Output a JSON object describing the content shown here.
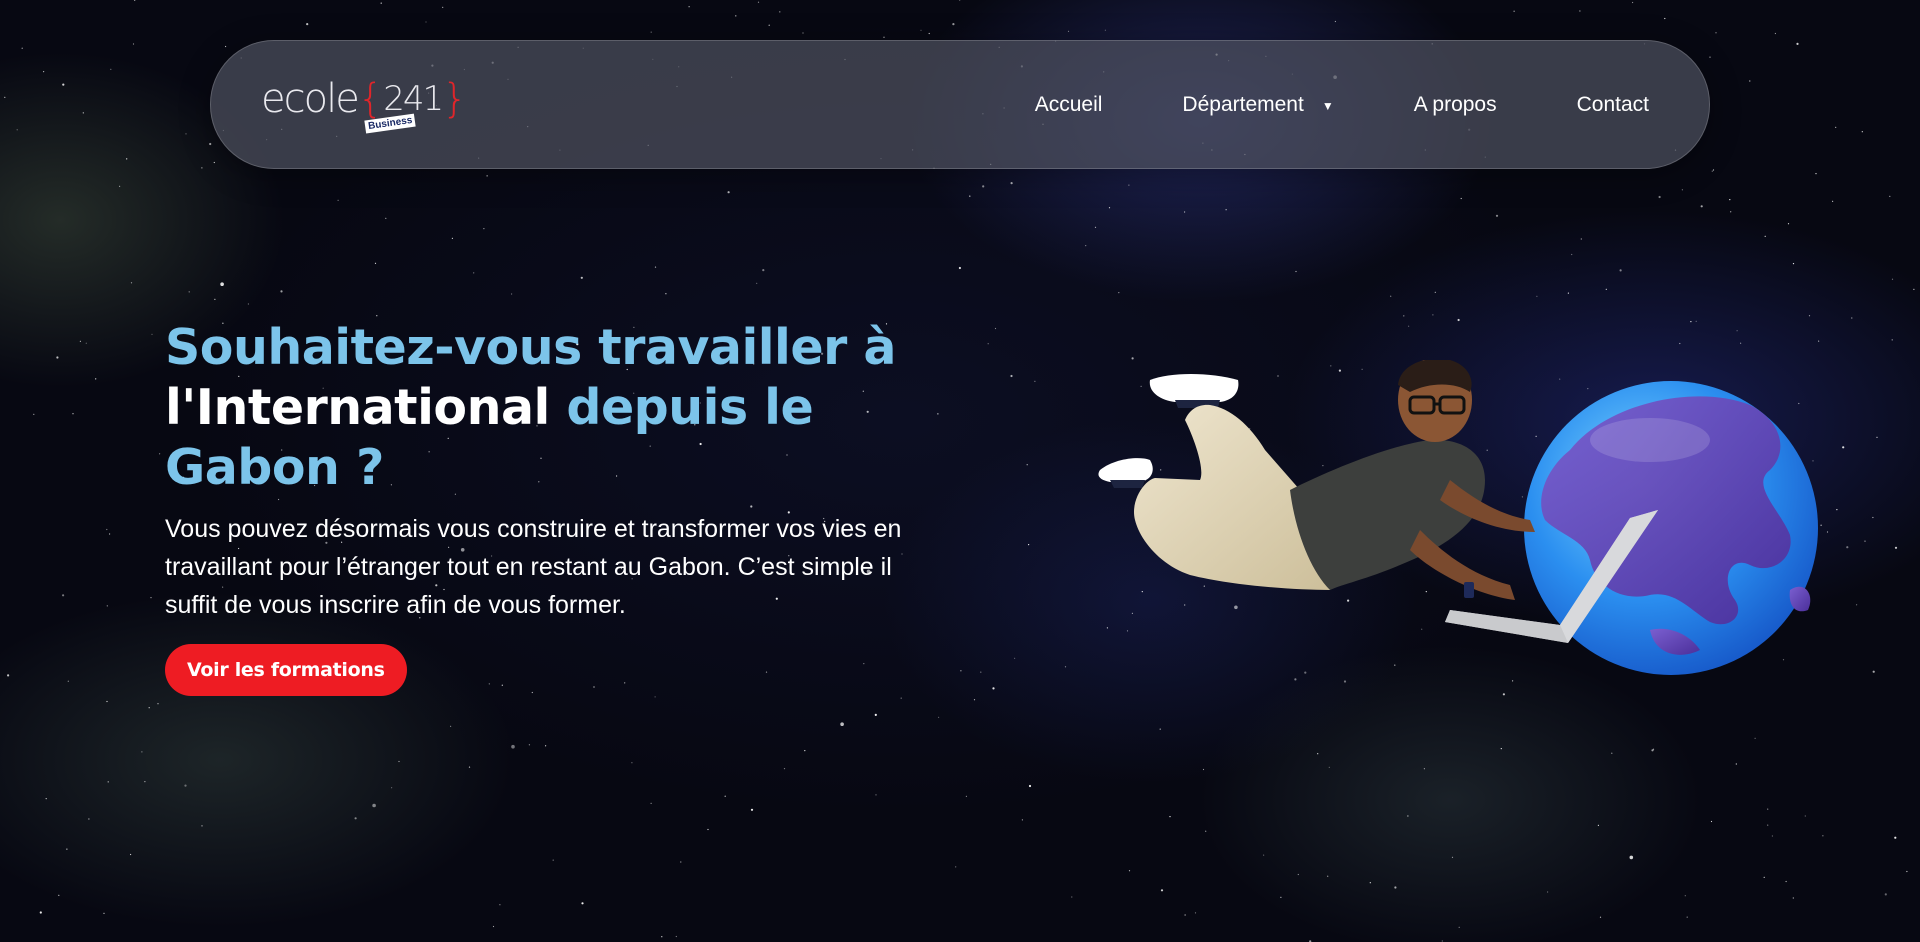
{
  "logo": {
    "word": "ecole",
    "open_brace": "{",
    "number": "241",
    "close_brace": "}",
    "tag": "Business"
  },
  "nav": {
    "items": [
      {
        "label": "Accueil"
      },
      {
        "label": "Département",
        "has_dropdown": true
      },
      {
        "label": "A propos"
      },
      {
        "label": "Contact"
      }
    ],
    "dropdown_glyph": "▼"
  },
  "hero": {
    "headline_part1": "Souhaitez-vous travailler à",
    "headline_part2": "l'International",
    "headline_part3": "depuis le Gabon ?",
    "subtitle": "Vous pouvez désormais vous construire et transformer vos vies en travaillant pour l’étranger tout en restant au Gabon. C’est simple il suffit de vous inscrire afin de vous former.",
    "cta_label": "Voir les formations"
  },
  "colors": {
    "accent_blue": "#7cc4ea",
    "cta_red": "#ee1c23",
    "logo_red": "#e0252a",
    "background": "#070812"
  },
  "illustration": {
    "icon": "person-flying-with-laptop-and-globe-illustration"
  }
}
